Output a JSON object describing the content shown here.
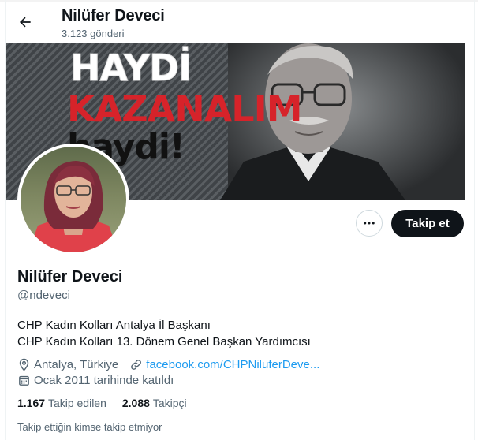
{
  "header": {
    "name": "Nilüfer Deveci",
    "posts_count": "3.123 gönderi"
  },
  "banner": {
    "line1": "HAYDİ",
    "line2": "KAZANALIM",
    "line3": "haydi!",
    "colors": {
      "white": "#ffffff",
      "red": "#d6232a",
      "black": "#111111"
    }
  },
  "actions": {
    "more_icon": "ellipsis-icon",
    "follow_label": "Takip et"
  },
  "profile": {
    "name": "Nilüfer Deveci",
    "handle": "@ndeveci",
    "bio_line1": "CHP Kadın Kolları Antalya İl Başkanı",
    "bio_line2": "CHP Kadın Kolları 13. Dönem Genel Başkan Yardımcısı",
    "location": "Antalya, Türkiye",
    "website": "facebook.com/CHPNiluferDeve...",
    "joined": "Ocak 2011 tarihinde katıldı"
  },
  "stats": {
    "following_count": "1.167",
    "following_label": "Takip edilen",
    "followers_count": "2.088",
    "followers_label": "Takipçi"
  },
  "footer": {
    "note": "Takip ettiğin kimse takip etmiyor"
  },
  "colors": {
    "text": "#0f1419",
    "muted": "#536471",
    "link": "#1d9bf0",
    "button": "#0f1419"
  }
}
